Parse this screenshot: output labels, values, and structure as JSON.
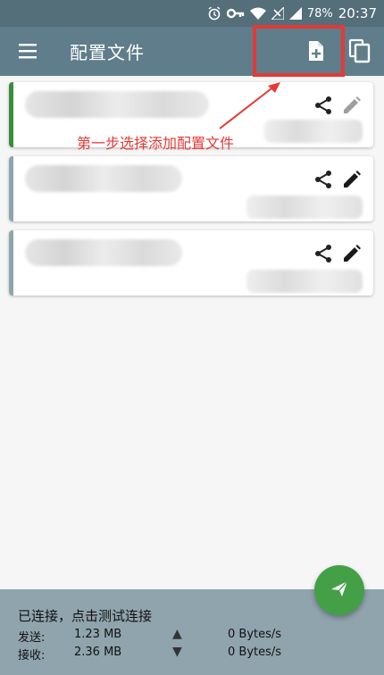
{
  "status_bar": {
    "battery": "78%",
    "time": "20:37",
    "icons": [
      "alarm-icon",
      "key-icon",
      "wifi-icon",
      "signal-off-icon",
      "signal-icon"
    ]
  },
  "app_bar": {
    "title": "配置文件",
    "menu_icon": "hamburger-menu-icon",
    "add_icon": "add-file-icon",
    "copy_icon": "copy-icon"
  },
  "annotation": {
    "text": "第一步选择添加配置文件"
  },
  "profiles": [
    {
      "active": true,
      "accent": "#388e3c",
      "edit_enabled": false
    },
    {
      "active": false,
      "accent": "#90a4ae",
      "edit_enabled": true
    },
    {
      "active": false,
      "accent": "#90a4ae",
      "edit_enabled": true
    }
  ],
  "bottom": {
    "status": "已连接，点击测试连接",
    "sent_label": "发送:",
    "sent_value": "1.23 MB",
    "recv_label": "接收:",
    "recv_value": "2.36 MB",
    "up_arrow": "▲",
    "down_arrow": "▼",
    "up_speed": "0 Bytes/s",
    "down_speed": "0 Bytes/s"
  },
  "colors": {
    "appbar": "#5f7d8b",
    "statusbar": "#546e7a",
    "fab": "#43a047",
    "annotation": "#e53935",
    "bottombar": "#90a4ae"
  }
}
